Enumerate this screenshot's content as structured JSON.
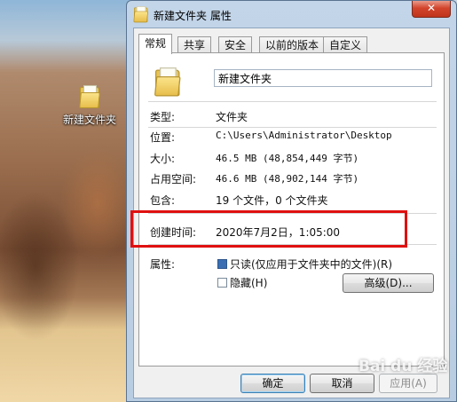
{
  "desktop": {
    "icon_label": "新建文件夹"
  },
  "window": {
    "title": "新建文件夹 属性",
    "close_label": "✕"
  },
  "tabs": [
    {
      "label": "常规",
      "active": true
    },
    {
      "label": "共享",
      "active": false
    },
    {
      "label": "安全",
      "active": false
    },
    {
      "label": "以前的版本",
      "active": false
    },
    {
      "label": "自定义",
      "active": false
    }
  ],
  "general": {
    "name_value": "新建文件夹",
    "type_label": "类型:",
    "type_value": "文件夹",
    "location_label": "位置:",
    "location_value": "C:\\Users\\Administrator\\Desktop",
    "size_label": "大小:",
    "size_value": "46.5 MB (48,854,449 字节)",
    "size_on_disk_label": "占用空间:",
    "size_on_disk_value": "46.6 MB (48,902,144 字节)",
    "contains_label": "包含:",
    "contains_value": "19 个文件，0 个文件夹",
    "created_label": "创建时间:",
    "created_value": "2020年7月2日，1:05:00",
    "attributes_label": "属性:",
    "readonly_label": "只读(仅应用于文件夹中的文件)(R)",
    "readonly_checked": true,
    "hidden_label": "隐藏(H)",
    "hidden_checked": false,
    "advanced_label": "高级(D)..."
  },
  "footer": {
    "ok_label": "确定",
    "cancel_label": "取消",
    "apply_label": "应用(A)"
  },
  "watermark": "Bai du 经验",
  "colors": {
    "highlight_border": "#e01010",
    "window_frame": "#b9cde2",
    "close_button": "#c0341c"
  }
}
